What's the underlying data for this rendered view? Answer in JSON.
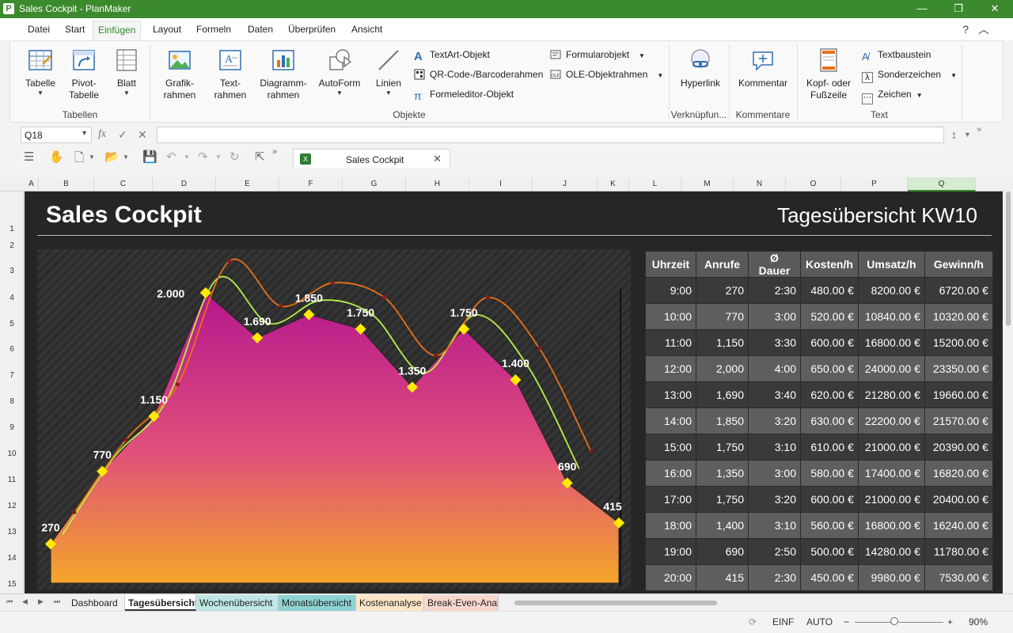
{
  "window": {
    "title": "Sales Cockpit - PlanMaker",
    "app_icon": "P",
    "minimize": "—",
    "maximize": "❐",
    "close": "✕"
  },
  "menu": [
    "Datei",
    "Start",
    "Einfügen",
    "Layout",
    "Formeln",
    "Daten",
    "Überprüfen",
    "Ansicht"
  ],
  "menu_active": "Einfügen",
  "menu_help": "?",
  "menu_collapse": "︿",
  "ribbon": {
    "tabelle": [
      "Tabelle"
    ],
    "pivot": [
      "Pivot-",
      "Tabelle"
    ],
    "blatt": [
      "Blatt"
    ],
    "grafik": [
      "Grafik-",
      "rahmen"
    ],
    "text": [
      "Text-",
      "rahmen"
    ],
    "diagramm": [
      "Diagramm-",
      "rahmen"
    ],
    "autoform": [
      "AutoForm"
    ],
    "linien": [
      "Linien"
    ],
    "textart": "TextArt-Objekt",
    "qrcode": "QR-Code-/Barcoderahmen",
    "formeleditor": "Formeleditor-Objekt",
    "formularobjekt": "Formularobjekt",
    "ole": "OLE-Objektrahmen",
    "hyperlink": [
      "Hyperlink"
    ],
    "kommentar": [
      "Kommentar"
    ],
    "kopf": [
      "Kopf- oder",
      "Fußzeile"
    ],
    "textbaustein": "Textbaustein",
    "sonderzeichen": "Sonderzeichen",
    "zeichen": "Zeichen",
    "group_tabellen": "Tabellen",
    "group_objekte": "Objekte",
    "group_verknuepfungen": "Verknüpfun...",
    "group_kommentare": "Kommentare",
    "group_text": "Text"
  },
  "formula_bar": {
    "cell_ref": "Q18",
    "fx": "fx",
    "value": ""
  },
  "doc_tab": {
    "name": "Sales Cockpit",
    "icon": "X"
  },
  "columns": [
    "A",
    "B",
    "C",
    "D",
    "E",
    "F",
    "G",
    "H",
    "I",
    "J",
    "K",
    "L",
    "M",
    "N",
    "O",
    "P",
    "Q"
  ],
  "selected_column": "Q",
  "rows": [
    "1",
    "2",
    "3",
    "4",
    "5",
    "6",
    "7",
    "8",
    "9",
    "10",
    "11",
    "12",
    "13",
    "14",
    "15"
  ],
  "sheet": {
    "title": "Sales Cockpit",
    "subtitle": "Tagesübersicht KW10"
  },
  "chart_data": {
    "type": "area",
    "categories": [
      "9:00",
      "10:00",
      "11:00",
      "12:00",
      "13:00",
      "14:00",
      "15:00",
      "16:00",
      "17:00",
      "18:00",
      "19:00",
      "20:00"
    ],
    "series": [
      {
        "values": [
          270,
          770,
          1150,
          2000,
          1690,
          1850,
          1750,
          1350,
          1750,
          1400,
          690,
          415
        ]
      }
    ],
    "data_labels": [
      "270",
      "770",
      "1.150",
      "2.000",
      "1.690",
      "1.850",
      "1.750",
      "1.350",
      "1.750",
      "1.400",
      "690",
      "415"
    ],
    "ylim": [
      0,
      2300
    ],
    "grid": false,
    "colors": {
      "area_top": "#b5178e",
      "area_bottom": "#f4a52a",
      "marker": "#ffea00",
      "line_green": "#b6f04a",
      "line_orange": "#e8701a"
    }
  },
  "table": {
    "headers": [
      "Uhrzeit",
      "Anrufe",
      "Ø Dauer",
      "Kosten/h",
      "Umsatz/h",
      "Gewinn/h"
    ],
    "rows": [
      [
        "9:00",
        "270",
        "2:30",
        "480.00 €",
        "8200.00 €",
        "6720.00 €"
      ],
      [
        "10:00",
        "770",
        "3:00",
        "520.00 €",
        "10840.00 €",
        "10320.00 €"
      ],
      [
        "11:00",
        "1,150",
        "3:30",
        "600.00 €",
        "16800.00 €",
        "15200.00 €"
      ],
      [
        "12:00",
        "2,000",
        "4:00",
        "650.00 €",
        "24000.00 €",
        "23350.00 €"
      ],
      [
        "13:00",
        "1,690",
        "3:40",
        "620.00 €",
        "21280.00 €",
        "19660.00 €"
      ],
      [
        "14:00",
        "1,850",
        "3:20",
        "630.00 €",
        "22200.00 €",
        "21570.00 €"
      ],
      [
        "15:00",
        "1,750",
        "3:10",
        "610.00 €",
        "21000.00 €",
        "20390.00 €"
      ],
      [
        "16:00",
        "1,350",
        "3:00",
        "580.00 €",
        "17400.00 €",
        "16820.00 €"
      ],
      [
        "17:00",
        "1,750",
        "3:20",
        "600.00 €",
        "21000.00 €",
        "20400.00 €"
      ],
      [
        "18:00",
        "1,400",
        "3:10",
        "560.00 €",
        "16800.00 €",
        "16240.00 €"
      ],
      [
        "19:00",
        "690",
        "2:50",
        "500.00 €",
        "14280.00 €",
        "11780.00 €"
      ],
      [
        "20:00",
        "415",
        "2:30",
        "450.00 €",
        "9980.00 €",
        "7530.00 €"
      ]
    ]
  },
  "sheet_tabs": [
    {
      "label": "Dashboard",
      "color": "#f0f0f0"
    },
    {
      "label": "Tagesübersicht",
      "color": "#ffffff",
      "active": true
    },
    {
      "label": "Wochenübersicht",
      "color": "#bfe6e6"
    },
    {
      "label": "Monatsübersicht",
      "color": "#8fd3d3"
    },
    {
      "label": "Kostenanalyse",
      "color": "#fde6c8"
    },
    {
      "label": "Break-Even-Analy",
      "color": "#f8d7cf"
    }
  ],
  "status": {
    "mode": "EINF",
    "calc": "AUTO",
    "zoom": "90%",
    "zoom_level": 0.45,
    "zoom_minus": "−",
    "zoom_plus": "+"
  }
}
